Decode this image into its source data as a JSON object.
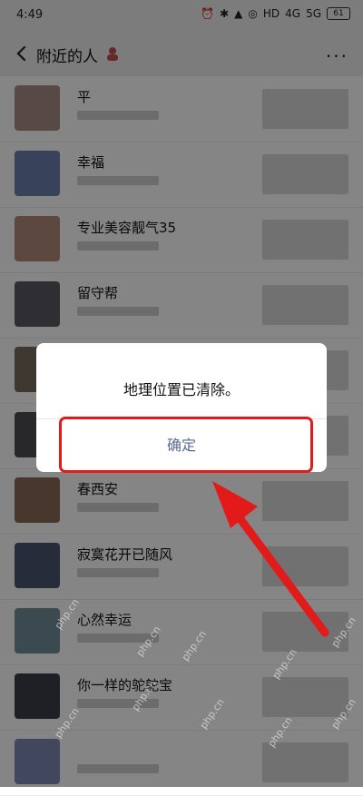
{
  "status": {
    "time": "4:49",
    "battery": "61",
    "net1": "HD",
    "net2": "4G",
    "net3": "5G"
  },
  "nav": {
    "title": "附近的人"
  },
  "list": [
    {
      "name": "平"
    },
    {
      "name": "幸福"
    },
    {
      "name": "专业美容靓气35"
    },
    {
      "name": "留守帮"
    },
    {
      "name": ""
    },
    {
      "name": ""
    },
    {
      "name": "春西安"
    },
    {
      "name": "寂寞花开已随风"
    },
    {
      "name": "心然幸运"
    },
    {
      "name": "你一样的鸵鸵宝"
    },
    {
      "name": ""
    }
  ],
  "dialog": {
    "message": "地理位置已清除。",
    "confirm_label": "确定"
  },
  "watermark": "php.cn",
  "colors": {
    "confirm": "#576b95",
    "highlight": "#e21a1a",
    "overlay": "rgba(0,0,0,0.48)"
  }
}
